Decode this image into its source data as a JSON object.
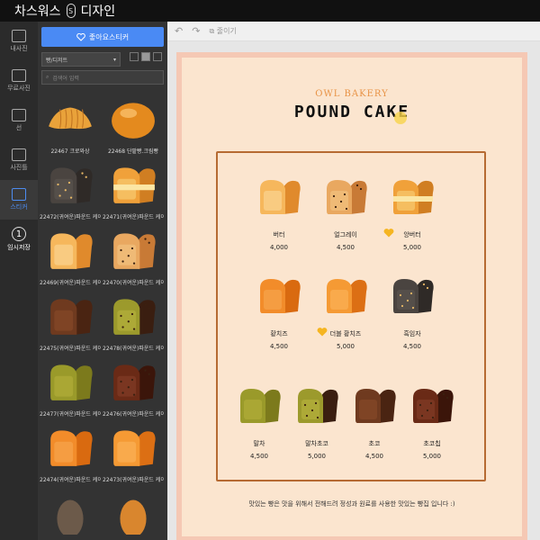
{
  "app": {
    "title_left": "차스워스",
    "logo_glyph": "S",
    "title_right": "디자인"
  },
  "rail": [
    {
      "label": "내사진",
      "icon": "camera-icon"
    },
    {
      "label": "무료사진",
      "icon": "images-icon"
    },
    {
      "label": "선",
      "icon": "lines-icon"
    },
    {
      "label": "사진틀",
      "icon": "frame-icon"
    },
    {
      "label": "스티커",
      "icon": "heart-icon",
      "active": true
    },
    {
      "label": "임시저장",
      "icon": "number-one-icon",
      "num": "1"
    }
  ],
  "panel": {
    "fav_button": "좋아요스티커",
    "category_value": "빵/디저트",
    "search_placeholder": "검색어 입력",
    "items": [
      {
        "caption": "22467 크로와상",
        "kind": "croissant"
      },
      {
        "caption": "22468 단팥빵.크림빵",
        "kind": "bun"
      },
      {
        "caption": "22472(귀여운)파운드 케이크",
        "kind": "dark"
      },
      {
        "caption": "22471(귀여운)파운드 케이크",
        "kind": "cream"
      },
      {
        "caption": "22469(귀여운)파운드 케이크",
        "kind": "plain"
      },
      {
        "caption": "22470(귀여운)파운드 케이크",
        "kind": "speckled"
      },
      {
        "caption": "22475(귀여운)파운드 케이크",
        "kind": "choco"
      },
      {
        "caption": "22478(귀여운)파운드 케이크",
        "kind": "greendark"
      },
      {
        "caption": "22477(귀여운)파운드 케이크",
        "kind": "matcha"
      },
      {
        "caption": "22476(귀여운)파운드 케이크",
        "kind": "chocochip"
      },
      {
        "caption": "22474(귀여운)파운드 케이크",
        "kind": "orange"
      },
      {
        "caption": "22473(귀여운)파운드 케이크",
        "kind": "orange2"
      },
      {
        "caption": "",
        "kind": "madeleine"
      },
      {
        "caption": "",
        "kind": "madeleine2"
      }
    ]
  },
  "toolbar": {
    "undo_icon": "undo-icon",
    "redo_icon": "redo-icon",
    "capture_label": "줄이기"
  },
  "poster": {
    "brand": "OWL BAKERY",
    "title": "POUND CAKE",
    "items": [
      {
        "name": "버터",
        "price": "4,000",
        "kind": "plain"
      },
      {
        "name": "얼그레이",
        "price": "4,500",
        "kind": "speckled"
      },
      {
        "name": "앙버터",
        "price": "5,000",
        "kind": "cream",
        "heart": true
      },
      {
        "name": "황치즈",
        "price": "4,500",
        "kind": "orange"
      },
      {
        "name": "더블 황치즈",
        "price": "5,000",
        "kind": "orange2",
        "heart": true
      },
      {
        "name": "흑임자",
        "price": "4,500",
        "kind": "dark"
      },
      {
        "name": "말차",
        "price": "4,500",
        "kind": "matcha"
      },
      {
        "name": "말차초코",
        "price": "5,000",
        "kind": "greendark"
      },
      {
        "name": "초코",
        "price": "4,500",
        "kind": "choco"
      },
      {
        "name": "초코칩",
        "price": "5,000",
        "kind": "chocochip"
      }
    ],
    "footer": "맛있는 빵은 맛을 위해서 전해드려 정성과 원료를 사용한 맛있는 빵집 입니다 :)"
  },
  "colors": {
    "accent": "#4a8af4",
    "frame": "#b66a32",
    "paper": "#fbe5cf",
    "border": "#f5c8b4"
  }
}
